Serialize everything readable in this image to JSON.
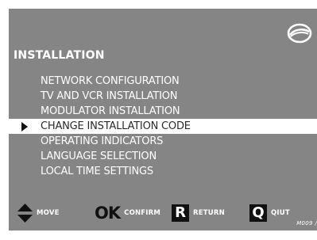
{
  "header": {
    "logo_icon": "ring-logo-icon",
    "title": "INSTALLATION"
  },
  "menu": {
    "selected_index": 3,
    "items": [
      {
        "label": "NETWORK CONFIGURATION"
      },
      {
        "label": "TV AND VCR INSTALLATION"
      },
      {
        "label": "MODULATOR INSTALLATION"
      },
      {
        "label": "CHANGE INSTALLATION CODE"
      },
      {
        "label": "OPERATING INDICATORS"
      },
      {
        "label": "LANGUAGE SELECTION"
      },
      {
        "label": "LOCAL TIME SETTINGS"
      }
    ]
  },
  "footer": {
    "move": {
      "icon": "up-down-arrows-icon",
      "label": "MOVE"
    },
    "confirm": {
      "glyph": "OK",
      "label": "CONFIRM"
    },
    "return": {
      "glyph": "R",
      "label": "RETURN"
    },
    "quit": {
      "glyph": "Q",
      "label": "QIUT"
    }
  },
  "watermark": "M009 /",
  "colors": {
    "screen_background": "#858585",
    "text": "#ffffff",
    "highlight": "#ffffff",
    "keys": "#111111"
  }
}
